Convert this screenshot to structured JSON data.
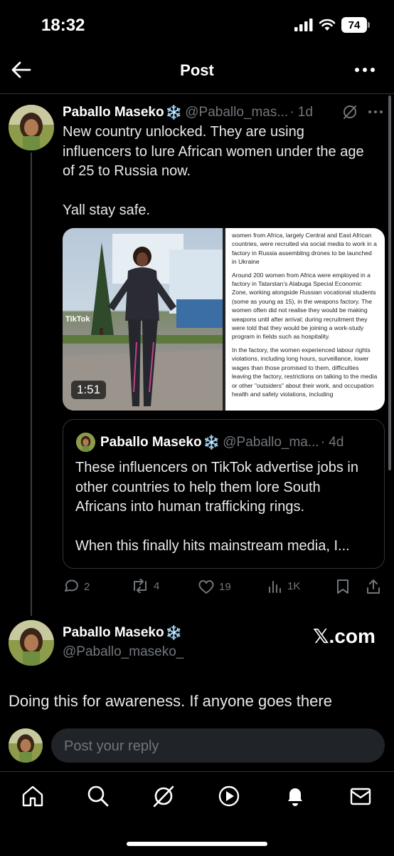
{
  "status_bar": {
    "time": "18:32",
    "battery": "74"
  },
  "header": {
    "title": "Post"
  },
  "main_post": {
    "author_name": "Paballo Maseko",
    "author_emoji": "❄️",
    "handle": "@Paballo_mas...",
    "time": "· 1d",
    "text": "New country unlocked. They are using influencers to lure African women under the age of 25 to Russia now.\n\nYall stay safe.",
    "media": {
      "duration": "1:51",
      "tiktok_label": "TikTok",
      "article_paragraphs": [
        "women from Africa, largely Central and East African countries, were recruited via social media to work in a factory in Russia assembling drones to be launched in Ukraine",
        "Around 200 women from Africa were employed in a factory in Tatarstan's Alabuga Special Economic Zone, working alongside Russian vocational students (some as young as 15), in the weapons factory. The women often did not realise they would be making weapons until after arrival; during recruitment they were told that they would be joining a work-study program in fields such as hospitality.",
        "In the factory, the women experienced labour rights violations, including long hours, surveillance, lower wages than those promised to them, difficulties leaving the factory, restrictions on talking to the media or other \"outsiders\" about their work, and occupation health and safety violations, including"
      ]
    },
    "quote": {
      "author_name": "Paballo Maseko",
      "author_emoji": "❄️",
      "handle": "@Paballo_ma...",
      "time": "· 4d",
      "text": "These influencers on TikTok advertise jobs in other countries to help them lore South Africans into human trafficking rings.\n\nWhen this finally hits mainstream media, I..."
    },
    "actions": {
      "replies": "2",
      "reposts": "4",
      "likes": "19",
      "views": "1K"
    }
  },
  "second_post": {
    "author_name": "Paballo Maseko",
    "author_emoji": "❄️",
    "handle": "@Paballo_maseko_",
    "watermark": "𝕏.com",
    "text": "Doing this for awareness. If anyone goes there"
  },
  "reply": {
    "placeholder": "Post your reply"
  }
}
